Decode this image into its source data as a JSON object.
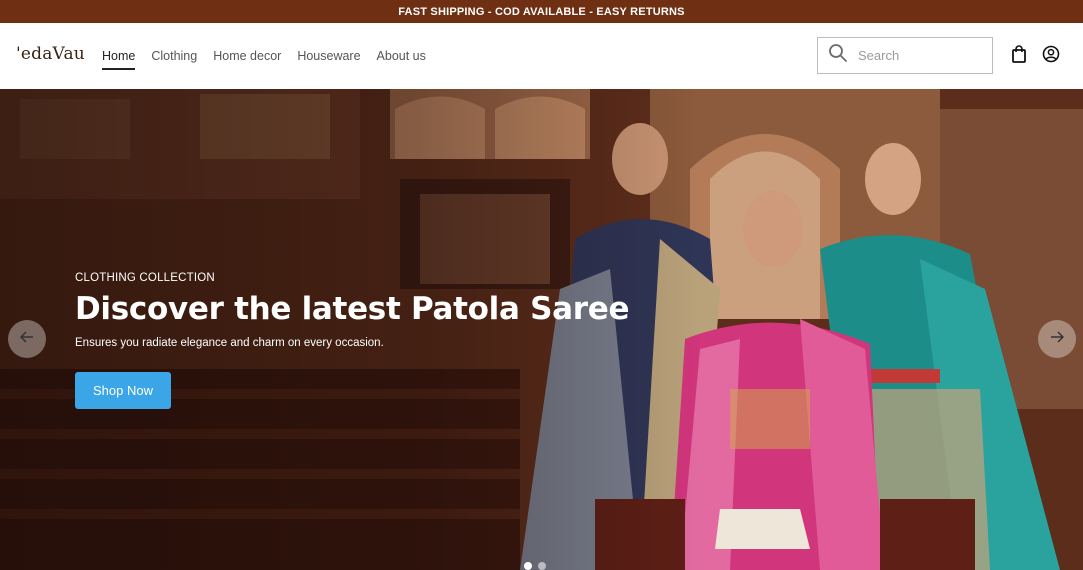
{
  "announcement": "FAST SHIPPING - COD AVAILABLE - EASY RETURNS",
  "brand": {
    "logo_text": "'edaVau"
  },
  "nav": {
    "items": [
      {
        "label": "Home",
        "active": true
      },
      {
        "label": "Clothing",
        "active": false
      },
      {
        "label": "Home decor",
        "active": false
      },
      {
        "label": "Houseware",
        "active": false
      },
      {
        "label": "About us",
        "active": false
      }
    ]
  },
  "search": {
    "placeholder": "Search",
    "value": ""
  },
  "header_icons": [
    "search-icon",
    "shopping-bag-icon",
    "account-icon"
  ],
  "hero": {
    "eyebrow": "CLOTHING COLLECTION",
    "title": "Discover the latest Patola Saree",
    "subtitle": "Ensures you radiate elegance and charm on every occasion.",
    "cta_label": "Shop Now",
    "slide_count": 2,
    "active_slide": 1
  },
  "colors": {
    "announcement_bg": "#6e2f12",
    "cta_bg": "#3aa6e8",
    "text_dark": "#222222"
  }
}
